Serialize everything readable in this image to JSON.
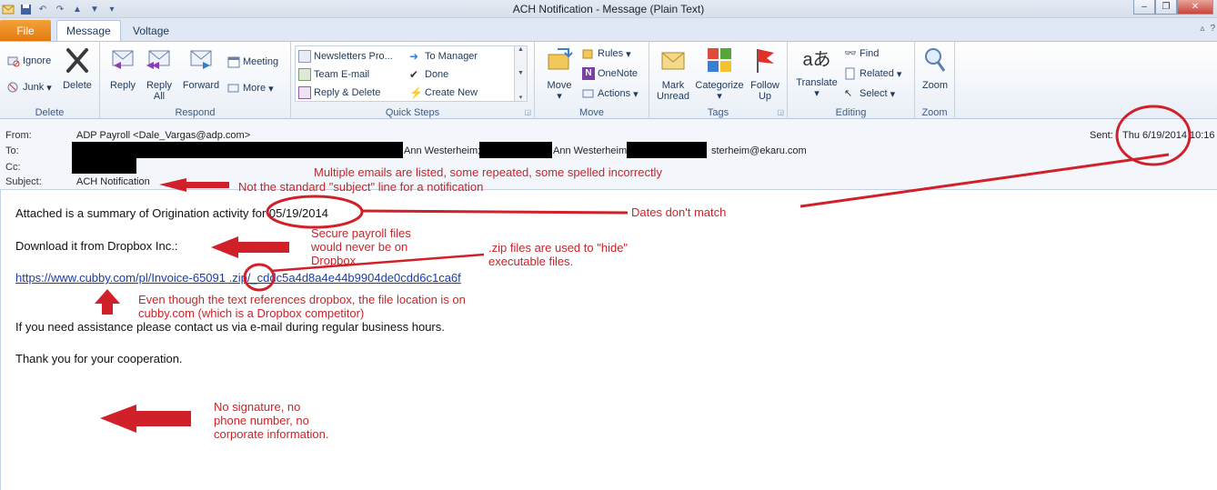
{
  "window": {
    "title": "ACH Notification - Message (Plain Text)"
  },
  "tabs": {
    "file": "File",
    "message": "Message",
    "voltage": "Voltage"
  },
  "ribbon": {
    "delete_group": {
      "label": "Delete",
      "ignore": "Ignore",
      "junk": "Junk",
      "delete": "Delete"
    },
    "respond_group": {
      "label": "Respond",
      "reply": "Reply",
      "reply_all_1": "Reply",
      "reply_all_2": "All",
      "forward": "Forward",
      "meeting": "Meeting",
      "more": "More"
    },
    "quick_steps_group": {
      "label": "Quick Steps",
      "items": [
        "Newsletters Pro...",
        "Team E-mail",
        "Reply & Delete",
        "To Manager",
        "Done",
        "Create New"
      ]
    },
    "move_group": {
      "label": "Move",
      "move": "Move",
      "rules": "Rules",
      "onenote": "OneNote",
      "actions": "Actions"
    },
    "tags_group": {
      "label": "Tags",
      "mark_unread_1": "Mark",
      "mark_unread_2": "Unread",
      "categorize": "Categorize",
      "follow_up_1": "Follow",
      "follow_up_2": "Up"
    },
    "editing_group": {
      "label": "Editing",
      "translate": "Translate",
      "find": "Find",
      "related": "Related",
      "select": "Select"
    },
    "zoom_group": {
      "label": "Zoom",
      "zoom": "Zoom"
    }
  },
  "header": {
    "from_label": "From:",
    "from_value": "ADP Payroll <Dale_Vargas@adp.com>",
    "to_label": "To:",
    "to_name_1": "Ann Westerheim;",
    "to_name_2": "Ann Westerheim;",
    "to_name_3": "sterheim@ekaru.com",
    "cc_label": "Cc:",
    "subject_label": "Subject:",
    "subject_value": "ACH Notification",
    "sent_label": "Sent:",
    "sent_value": "Thu 6/19/2014 10:16"
  },
  "body": {
    "line1_prefix": "Attached is a summary of Origination activity for",
    "line1_date": "05/19/2014",
    "line2": "Download it from Dropbox Inc.:",
    "link": "https://www.cubby.com/pl/Invoice-65091 .zip/_cddc5a4d8a4e44b9904de0cdd6c1ca6f",
    "line4": "If you need assistance please contact us via e-mail during regular business hours.",
    "line5": "Thank you for your cooperation."
  },
  "annotations": {
    "multiple_emails": "Multiple emails are listed, some repeated, some spelled incorrectly",
    "subject_note": "Not the standard \"subject\" line for a notification",
    "dates": "Dates don't match",
    "secure_payroll": "Secure payroll files would never be on Dropbox",
    "zip_files": ".zip files are used to \"hide\" executable files.",
    "cubby": "Even though the text references dropbox, the file location is on cubby.com (which is a Dropbox competitor)",
    "no_signature": "No signature, no phone number, no corporate information."
  },
  "colors": {
    "annotation_red": "#c8252a",
    "file_tab_orange": "#e47a10",
    "ribbon_text": "#1e395b",
    "link_blue": "#1a3ca8"
  }
}
